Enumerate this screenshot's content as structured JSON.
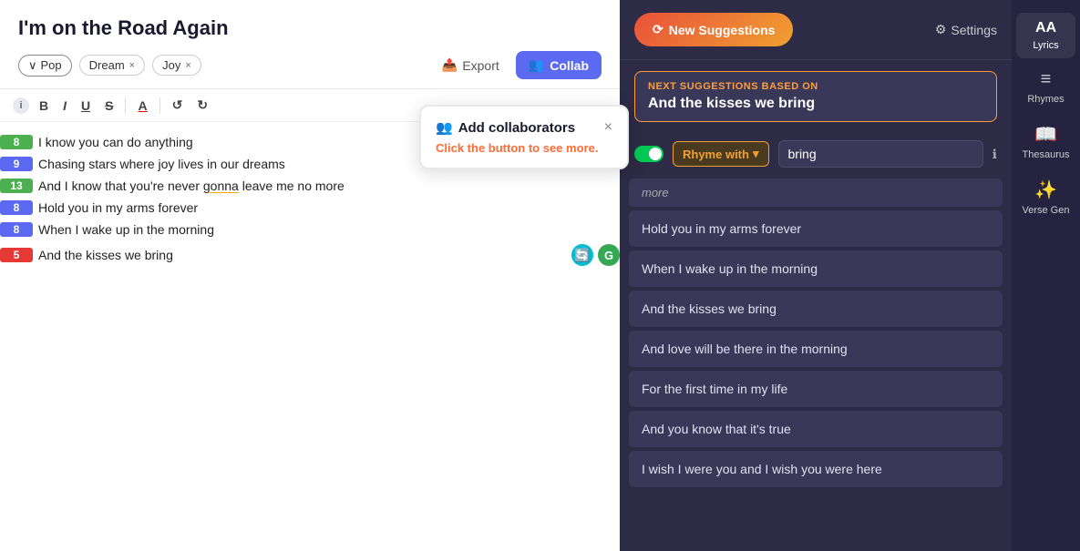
{
  "editor": {
    "title": "I'm on the Road Again",
    "genre_label": "Pop",
    "tags": [
      {
        "label": "Dream",
        "removable": true
      },
      {
        "label": "Joy",
        "removable": true
      }
    ],
    "export_label": "Export",
    "collab_label": "Collab",
    "toolbar": {
      "bold": "B",
      "italic": "I",
      "underline": "U",
      "strikethrough": "S",
      "font_color": "A",
      "undo": "↺",
      "redo": "↻"
    },
    "lines": [
      {
        "score": "8",
        "score_color": "green",
        "text": "I know you can do anything",
        "special": false
      },
      {
        "score": "9",
        "score_color": "blue",
        "text": "Chasing stars where joy lives in our dreams",
        "special": false
      },
      {
        "score": "13",
        "score_color": "green",
        "text": "And I know that you're never gonna leave me no more",
        "special": false,
        "underline_word": "gonna"
      },
      {
        "score": "8",
        "score_color": "blue",
        "text": "Hold you in my arms forever",
        "special": false
      },
      {
        "score": "8",
        "score_color": "blue",
        "text": "When I wake up in the morning",
        "special": false
      },
      {
        "score": "5",
        "score_color": "red",
        "text": "And the kisses we bring",
        "special": true
      }
    ]
  },
  "tooltip": {
    "title": "Add collaborators",
    "icon": "👥",
    "close": "×",
    "body": "Click the button to see more."
  },
  "suggestions": {
    "new_btn_label": "New Suggestions",
    "new_btn_icon": "⟳",
    "settings_label": "Settings",
    "settings_icon": "⚙",
    "based_on_label": "Next suggestions based on",
    "based_on_phrase": "And the kisses we bring",
    "rhyme_toggle": true,
    "rhyme_label": "Rhyme with",
    "rhyme_value": "bring",
    "info_icon": "ℹ",
    "more_text": "more",
    "items": [
      "Hold you in my arms forever",
      "When I wake up in the morning",
      "And the kisses we bring",
      "And love will be there in the morning",
      "For the first time in my life",
      "And you know that it's true",
      "I wish I were you and I wish you were here"
    ]
  },
  "sidebar": {
    "items": [
      {
        "label": "Lyrics",
        "icon": "AA",
        "active": true
      },
      {
        "label": "Rhymes",
        "icon": "≡↕",
        "active": false
      },
      {
        "label": "Thesaurus",
        "icon": "📖",
        "active": false
      },
      {
        "label": "Verse Gen",
        "icon": "✨",
        "active": false
      }
    ]
  }
}
